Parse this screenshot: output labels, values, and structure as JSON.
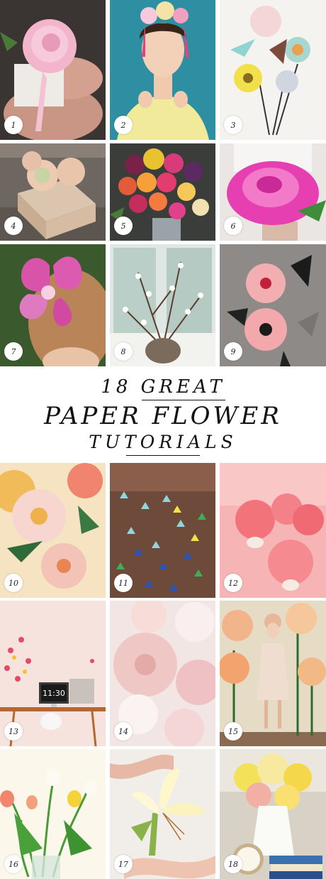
{
  "title": {
    "line1": "18 GREAT",
    "line2": "PAPER FLOWER",
    "line3": "TUTORIALS"
  },
  "tiles": [
    {
      "number": "1",
      "caption": "pink paper rose held in hands"
    },
    {
      "number": "2",
      "caption": "woman wearing paper flower crown"
    },
    {
      "number": "3",
      "caption": "bouquet of paper flowers"
    },
    {
      "number": "4",
      "caption": "kraft paper flowers on gift box"
    },
    {
      "number": "5",
      "caption": "colorful rolled paper flower bouquet"
    },
    {
      "number": "6",
      "caption": "giant magenta paper rose"
    },
    {
      "number": "7",
      "caption": "paper orchid hair clip"
    },
    {
      "number": "8",
      "caption": "paper cherry blossom branches in vase"
    },
    {
      "number": "9",
      "caption": "pink poppies with striped leaves"
    },
    {
      "number": "10",
      "caption": "peach and coral paper peonies"
    },
    {
      "number": "11",
      "caption": "hanging origami flower installation"
    },
    {
      "number": "12",
      "caption": "coral paper dahlias"
    },
    {
      "number": "13",
      "caption": "paper blossom branches on desk"
    },
    {
      "number": "14",
      "caption": "blush paper flower wall"
    },
    {
      "number": "15",
      "caption": "giant paper flower backdrop with woman"
    },
    {
      "number": "16",
      "caption": "paper tulips and daffodils in glass"
    },
    {
      "number": "17",
      "caption": "paper lily with ribbon"
    },
    {
      "number": "18",
      "caption": "yellow paper flowers in white pitcher"
    }
  ]
}
